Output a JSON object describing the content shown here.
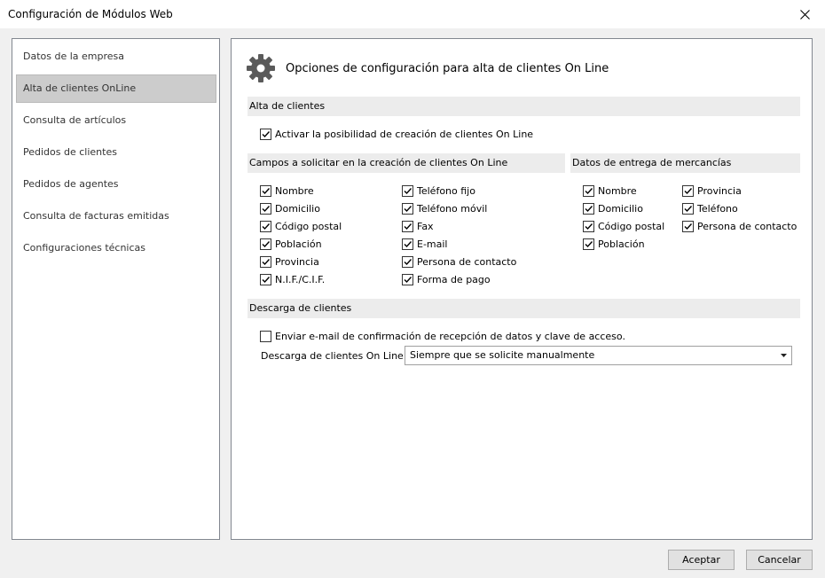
{
  "window": {
    "title": "Configuración de Módulos Web"
  },
  "nav": {
    "items": [
      {
        "label": "Datos de la empresa",
        "selected": false
      },
      {
        "label": "Alta de clientes OnLine",
        "selected": true
      },
      {
        "label": "Consulta de artículos",
        "selected": false
      },
      {
        "label": "Pedidos de clientes",
        "selected": false
      },
      {
        "label": "Pedidos de agentes",
        "selected": false
      },
      {
        "label": "Consulta de facturas emitidas",
        "selected": false
      },
      {
        "label": "Configuraciones técnicas",
        "selected": false
      }
    ]
  },
  "main": {
    "icon": "gear-icon",
    "title": "Opciones de configuración para alta de clientes On Line",
    "alta": {
      "header": "Alta de clientes",
      "activar": {
        "label": "Activar la posibilidad de creación de clientes On Line",
        "checked": true
      }
    },
    "campos": {
      "header": "Campos a solicitar en la creación de clientes On Line",
      "col1": [
        {
          "label": "Nombre",
          "checked": true
        },
        {
          "label": "Domicilio",
          "checked": true
        },
        {
          "label": "Código postal",
          "checked": true
        },
        {
          "label": "Población",
          "checked": true
        },
        {
          "label": "Provincia",
          "checked": true
        },
        {
          "label": "N.I.F./C.I.F.",
          "checked": true
        }
      ],
      "col2": [
        {
          "label": "Teléfono fijo",
          "checked": true
        },
        {
          "label": "Teléfono móvil",
          "checked": true
        },
        {
          "label": "Fax",
          "checked": true
        },
        {
          "label": "E-mail",
          "checked": true
        },
        {
          "label": "Persona de contacto",
          "checked": true
        },
        {
          "label": "Forma de pago",
          "checked": true
        }
      ]
    },
    "entrega": {
      "header": "Datos de entrega de mercancías",
      "col1": [
        {
          "label": "Nombre",
          "checked": true
        },
        {
          "label": "Domicilio",
          "checked": true
        },
        {
          "label": "Código postal",
          "checked": true
        },
        {
          "label": "Población",
          "checked": true
        }
      ],
      "col2": [
        {
          "label": "Provincia",
          "checked": true
        },
        {
          "label": "Teléfono",
          "checked": true
        },
        {
          "label": "Persona de contacto",
          "checked": true
        }
      ]
    },
    "descarga": {
      "header": "Descarga de clientes",
      "email": {
        "label": "Enviar e-mail de confirmación de recepción de datos y clave de acceso.",
        "checked": false
      },
      "select_label": "Descarga de clientes On Line:",
      "select_value": "Siempre que se solicite manualmente"
    }
  },
  "buttons": {
    "accept": "Aceptar",
    "cancel": "Cancelar"
  }
}
